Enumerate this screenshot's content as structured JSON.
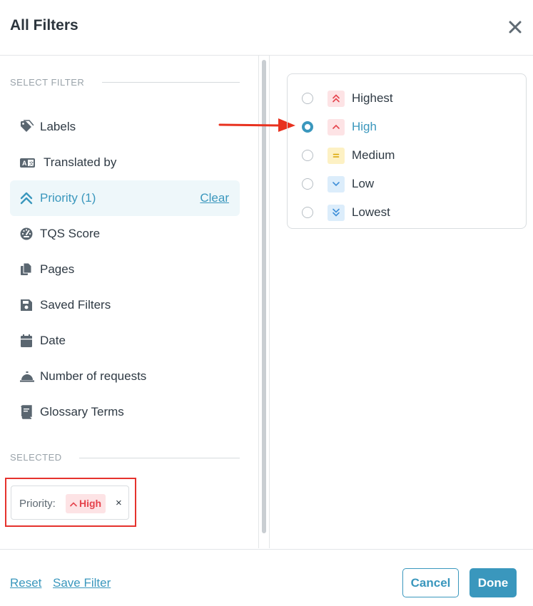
{
  "dialog": {
    "title": "All Filters"
  },
  "sidebar": {
    "select_filter_heading": "SELECT FILTER",
    "items": [
      {
        "label": "Labels",
        "icon": "tag-icon"
      },
      {
        "label": "Translated by",
        "icon": "translate-icon"
      },
      {
        "label": "Priority (1)",
        "icon": "double-chevron-up-icon",
        "active": true,
        "action": "Clear"
      },
      {
        "label": "TQS Score",
        "icon": "gauge-icon"
      },
      {
        "label": "Pages",
        "icon": "pages-icon"
      },
      {
        "label": "Saved Filters",
        "icon": "floppy-disk-icon"
      },
      {
        "label": "Date",
        "icon": "calendar-icon"
      },
      {
        "label": "Number of requests",
        "icon": "service-bell-icon"
      },
      {
        "label": "Glossary Terms",
        "icon": "book-icon"
      }
    ],
    "selected_heading": "SELECTED",
    "selected_chip": {
      "key": "Priority:",
      "value": "High",
      "remove": "×"
    }
  },
  "priority_options": [
    {
      "label": "Highest",
      "icon": "double-chevron-up-icon",
      "selected": false
    },
    {
      "label": "High",
      "icon": "chevron-up-icon",
      "selected": true
    },
    {
      "label": "Medium",
      "icon": "equals-icon",
      "selected": false
    },
    {
      "label": "Low",
      "icon": "chevron-down-icon",
      "selected": false
    },
    {
      "label": "Lowest",
      "icon": "double-chevron-down-icon",
      "selected": false
    }
  ],
  "footer": {
    "reset": "Reset",
    "save_filter": "Save Filter",
    "cancel": "Cancel",
    "done": "Done"
  },
  "colors": {
    "accent": "#3a97bd",
    "highlight_red": "#e5322d",
    "high_badge_bg": "#fde3e5",
    "medium_badge_bg": "#fdf1c4",
    "low_badge_bg": "#dcedfb"
  }
}
